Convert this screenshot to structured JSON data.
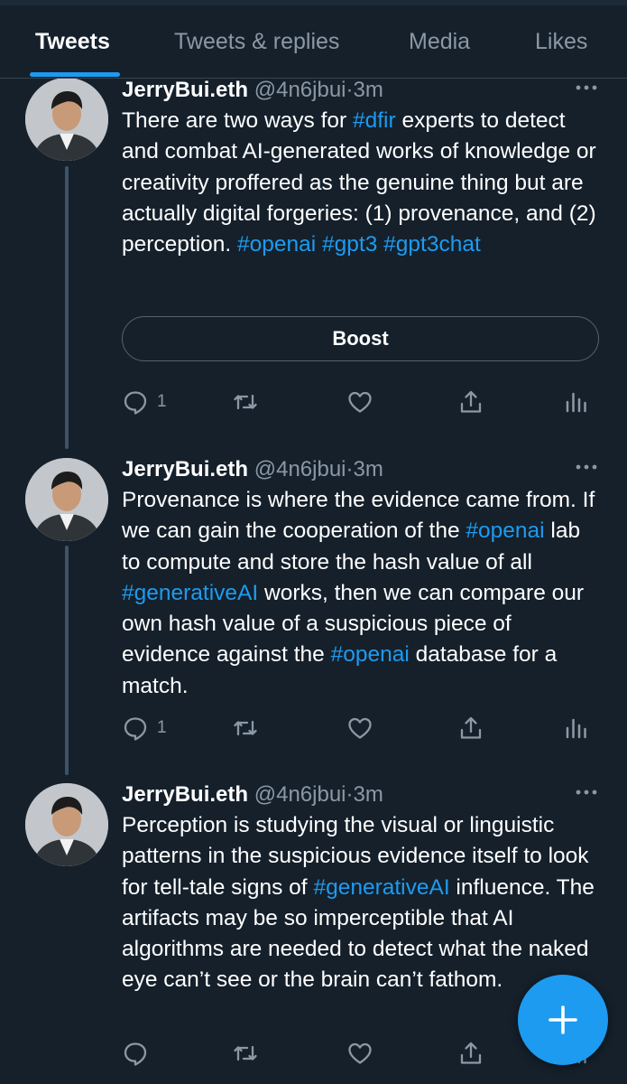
{
  "tabs": [
    {
      "label": "Tweets",
      "active": true
    },
    {
      "label": "Tweets & replies",
      "active": false
    },
    {
      "label": "Media",
      "active": false
    },
    {
      "label": "Likes",
      "active": false
    }
  ],
  "colors": {
    "background": "#15202b",
    "accent": "#1d9bf0",
    "muted": "#8b98a5",
    "divider": "#38444d"
  },
  "tweets": [
    {
      "name": "JerryBui.eth",
      "handle": "@4n6jbui",
      "separator": "·",
      "time": "3m",
      "more_icon": "more-horizontal-icon",
      "text_parts": [
        {
          "text": "There are two ways for ",
          "type": "text"
        },
        {
          "text": "#dfir",
          "type": "hashtag"
        },
        {
          "text": " experts to detect and combat AI-generated works of knowledge or creativity proffered as the genuine thing but are actually digital forgeries: (1) provenance, and (2) perception. ",
          "type": "text"
        },
        {
          "text": "#openai",
          "type": "hashtag"
        },
        {
          "text": " ",
          "type": "text"
        },
        {
          "text": "#gpt3",
          "type": "hashtag"
        },
        {
          "text": " ",
          "type": "text"
        },
        {
          "text": "#gpt3chat",
          "type": "hashtag"
        }
      ],
      "boost_label": "Boost",
      "actions": {
        "reply_count": "1",
        "retweet_count": "",
        "like_count": ""
      }
    },
    {
      "name": "JerryBui.eth",
      "handle": "@4n6jbui",
      "separator": "·",
      "time": "3m",
      "more_icon": "more-horizontal-icon",
      "text_parts": [
        {
          "text": "Provenance is where the evidence came from. If we can gain the cooperation of the ",
          "type": "text"
        },
        {
          "text": "#openai",
          "type": "hashtag"
        },
        {
          "text": " lab to compute and store the hash value of all ",
          "type": "text"
        },
        {
          "text": "#generativeAI",
          "type": "hashtag"
        },
        {
          "text": " works, then we can compare our own hash value of a suspicious piece of evidence against the ",
          "type": "text"
        },
        {
          "text": "#openai",
          "type": "hashtag"
        },
        {
          "text": " database for a match.",
          "type": "text"
        }
      ],
      "actions": {
        "reply_count": "1",
        "retweet_count": "",
        "like_count": ""
      }
    },
    {
      "name": "JerryBui.eth",
      "handle": "@4n6jbui",
      "separator": "·",
      "time": "3m",
      "more_icon": "more-horizontal-icon",
      "text_parts": [
        {
          "text": "Perception is studying the visual or linguistic patterns in the suspicious evidence itself to look for tell-tale signs of ",
          "type": "text"
        },
        {
          "text": "#generativeAI",
          "type": "hashtag"
        },
        {
          "text": " influence. The artifacts may be so imperceptible that AI algorithms are needed to detect what the naked eye can’t see or the brain can’t fathom.",
          "type": "text"
        }
      ],
      "actions": {
        "reply_count": "",
        "retweet_count": "",
        "like_count": ""
      }
    }
  ],
  "fab": {
    "icon": "plus-icon",
    "label": "Compose"
  }
}
